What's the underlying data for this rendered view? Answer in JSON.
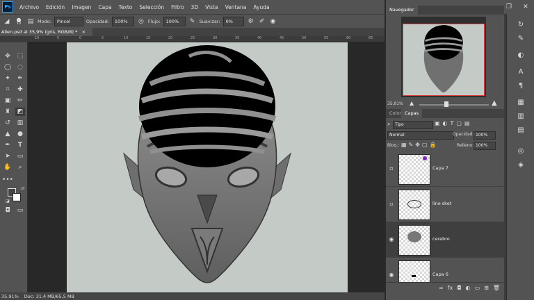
{
  "app": {
    "logo": "Ps"
  },
  "menu": [
    "Archivo",
    "Edición",
    "Imagen",
    "Capa",
    "Texto",
    "Selección",
    "Filtro",
    "3D",
    "Vista",
    "Ventana",
    "Ayuda"
  ],
  "window_buttons": {
    "minimize": "–",
    "restore": "❐",
    "close": "✕"
  },
  "options_bar": {
    "brush_size": "10",
    "mode_label": "Modo:",
    "mode_value": "Pincel",
    "opacity_label": "Opacidad:",
    "opacity_value": "100%",
    "flow_label": "Flujo:",
    "flow_value": "100%",
    "smoothing_label": "Suavizar:",
    "smoothing_value": "0%"
  },
  "document": {
    "tab_title": "Alien.psd al 35,9% (gris, RGB/8) *",
    "tab_close": "×"
  },
  "ruler": {
    "ticks": [
      "10",
      "5",
      "0",
      "5",
      "10",
      "15",
      "20",
      "25",
      "30",
      "35",
      "40",
      "45",
      "50",
      "55",
      "60",
      "65"
    ]
  },
  "status": {
    "zoom": "35,91%",
    "doc_info": "Doc: 31,4 MB/65,5 MB"
  },
  "navigator": {
    "tab": "Navegador",
    "zoom": "35,91%"
  },
  "layers_panel": {
    "tabs": [
      "Color",
      "Capas"
    ],
    "filter_value": "Tipo",
    "blend_mode": "Normal",
    "opacity_label": "Opacidad:",
    "opacity_value": "100%",
    "lock_label": "Bloq.:",
    "fill_label": "Relleno:",
    "fill_value": "100%",
    "layers": [
      {
        "name": "Capa 7",
        "visible": false
      },
      {
        "name": "line sket",
        "visible": false
      },
      {
        "name": "cerebro",
        "visible": true
      },
      {
        "name": "Capa 6",
        "visible": true
      }
    ]
  },
  "colors": {
    "foreground": "#ffffff",
    "background": "#444444",
    "canvas_bg": "#c4cbc7",
    "ui_panel": "#535353",
    "accent_red": "#e04040"
  }
}
